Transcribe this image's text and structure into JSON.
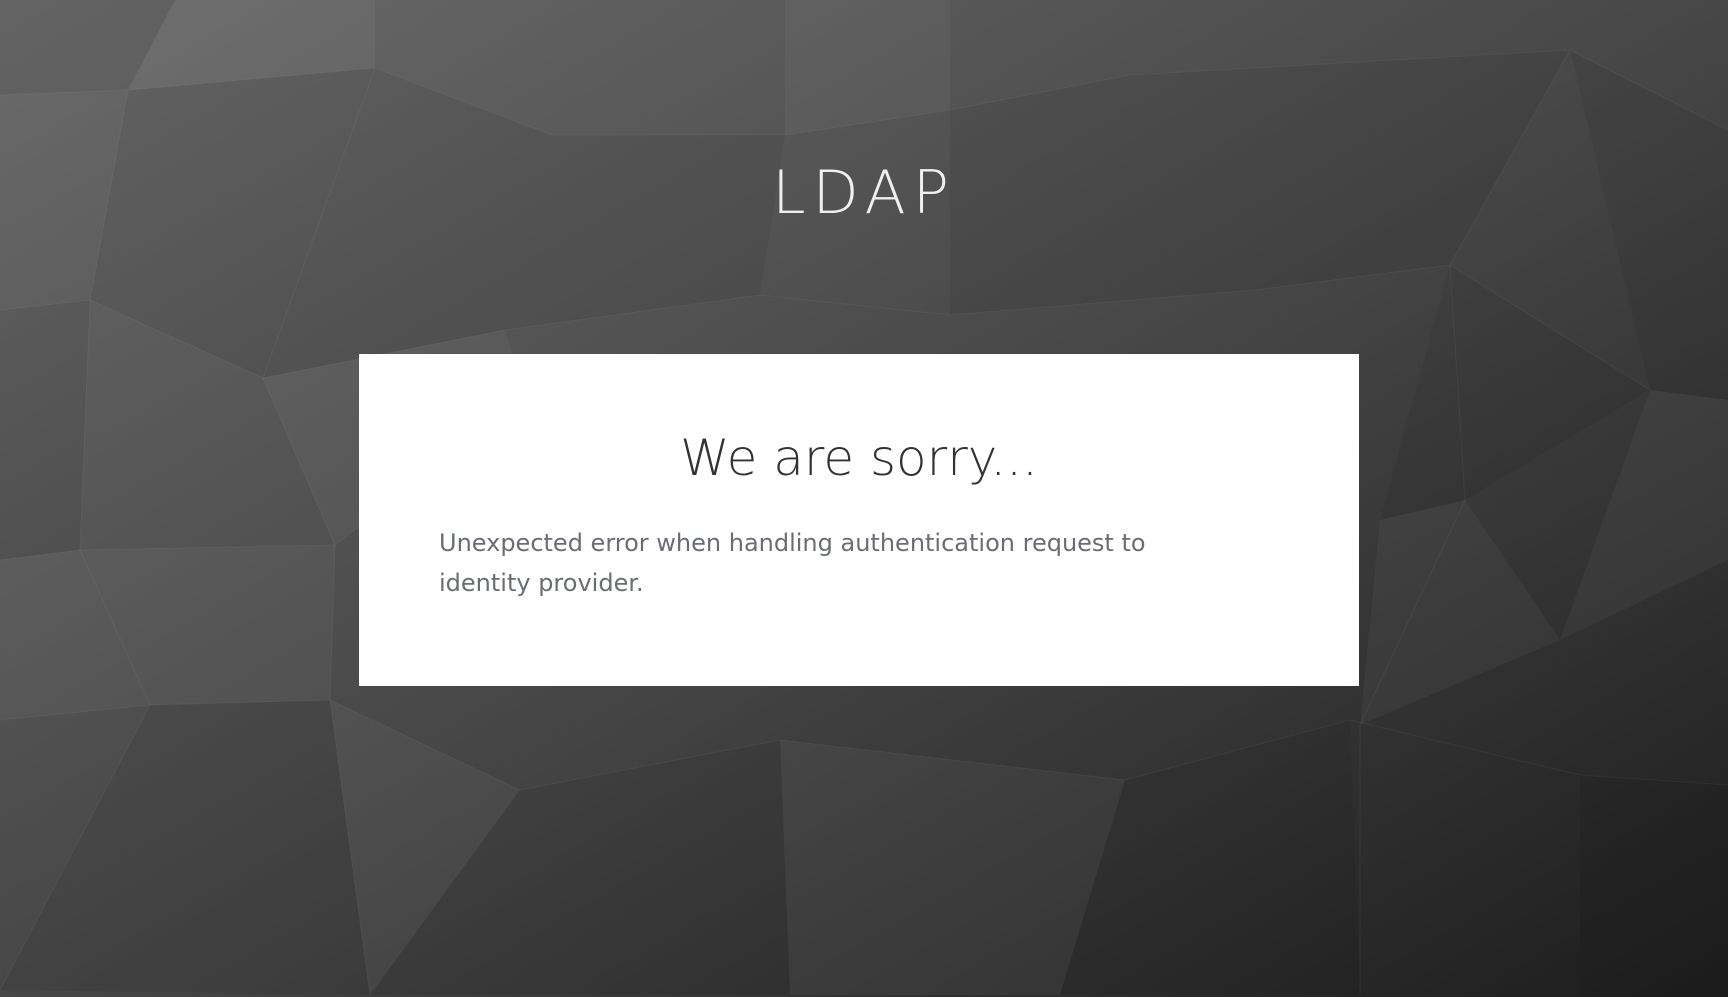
{
  "header": {
    "realm_name": "LDAP"
  },
  "error_card": {
    "title": "We are sorry...",
    "message": "Unexpected error when handling authentication request to identity provider."
  },
  "colors": {
    "card_background": "#ffffff",
    "title_text": "#333333",
    "message_text": "#6a6e73",
    "header_text": "#f0f0f0"
  }
}
